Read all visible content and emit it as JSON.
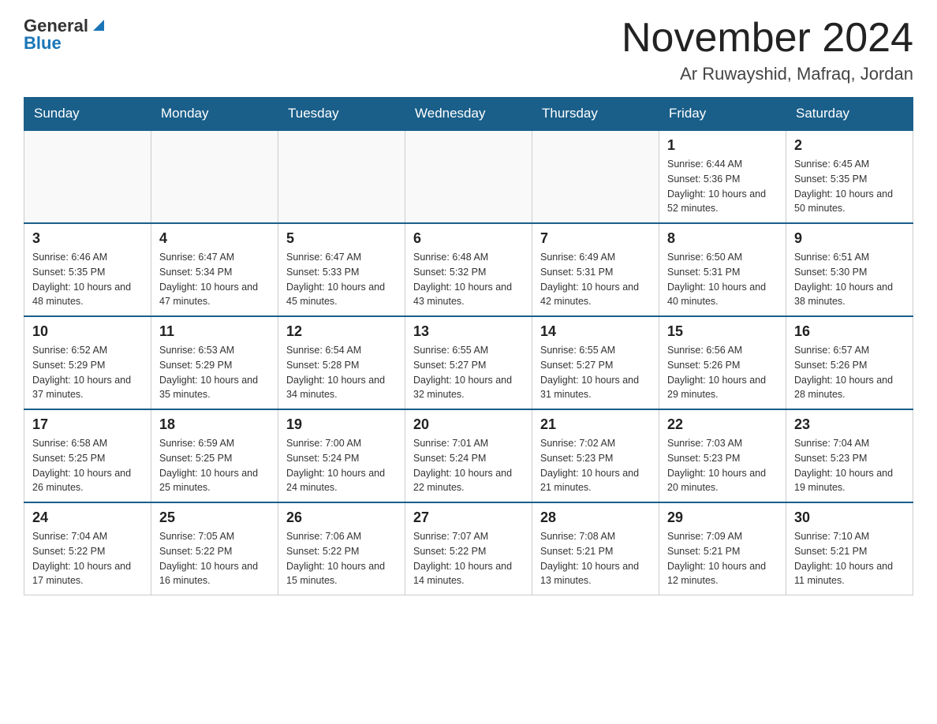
{
  "logo": {
    "general": "General",
    "blue": "Blue"
  },
  "title": {
    "month_year": "November 2024",
    "location": "Ar Ruwayshid, Mafraq, Jordan"
  },
  "weekdays": [
    "Sunday",
    "Monday",
    "Tuesday",
    "Wednesday",
    "Thursday",
    "Friday",
    "Saturday"
  ],
  "weeks": [
    [
      {
        "day": "",
        "info": ""
      },
      {
        "day": "",
        "info": ""
      },
      {
        "day": "",
        "info": ""
      },
      {
        "day": "",
        "info": ""
      },
      {
        "day": "",
        "info": ""
      },
      {
        "day": "1",
        "info": "Sunrise: 6:44 AM\nSunset: 5:36 PM\nDaylight: 10 hours and 52 minutes."
      },
      {
        "day": "2",
        "info": "Sunrise: 6:45 AM\nSunset: 5:35 PM\nDaylight: 10 hours and 50 minutes."
      }
    ],
    [
      {
        "day": "3",
        "info": "Sunrise: 6:46 AM\nSunset: 5:35 PM\nDaylight: 10 hours and 48 minutes."
      },
      {
        "day": "4",
        "info": "Sunrise: 6:47 AM\nSunset: 5:34 PM\nDaylight: 10 hours and 47 minutes."
      },
      {
        "day": "5",
        "info": "Sunrise: 6:47 AM\nSunset: 5:33 PM\nDaylight: 10 hours and 45 minutes."
      },
      {
        "day": "6",
        "info": "Sunrise: 6:48 AM\nSunset: 5:32 PM\nDaylight: 10 hours and 43 minutes."
      },
      {
        "day": "7",
        "info": "Sunrise: 6:49 AM\nSunset: 5:31 PM\nDaylight: 10 hours and 42 minutes."
      },
      {
        "day": "8",
        "info": "Sunrise: 6:50 AM\nSunset: 5:31 PM\nDaylight: 10 hours and 40 minutes."
      },
      {
        "day": "9",
        "info": "Sunrise: 6:51 AM\nSunset: 5:30 PM\nDaylight: 10 hours and 38 minutes."
      }
    ],
    [
      {
        "day": "10",
        "info": "Sunrise: 6:52 AM\nSunset: 5:29 PM\nDaylight: 10 hours and 37 minutes."
      },
      {
        "day": "11",
        "info": "Sunrise: 6:53 AM\nSunset: 5:29 PM\nDaylight: 10 hours and 35 minutes."
      },
      {
        "day": "12",
        "info": "Sunrise: 6:54 AM\nSunset: 5:28 PM\nDaylight: 10 hours and 34 minutes."
      },
      {
        "day": "13",
        "info": "Sunrise: 6:55 AM\nSunset: 5:27 PM\nDaylight: 10 hours and 32 minutes."
      },
      {
        "day": "14",
        "info": "Sunrise: 6:55 AM\nSunset: 5:27 PM\nDaylight: 10 hours and 31 minutes."
      },
      {
        "day": "15",
        "info": "Sunrise: 6:56 AM\nSunset: 5:26 PM\nDaylight: 10 hours and 29 minutes."
      },
      {
        "day": "16",
        "info": "Sunrise: 6:57 AM\nSunset: 5:26 PM\nDaylight: 10 hours and 28 minutes."
      }
    ],
    [
      {
        "day": "17",
        "info": "Sunrise: 6:58 AM\nSunset: 5:25 PM\nDaylight: 10 hours and 26 minutes."
      },
      {
        "day": "18",
        "info": "Sunrise: 6:59 AM\nSunset: 5:25 PM\nDaylight: 10 hours and 25 minutes."
      },
      {
        "day": "19",
        "info": "Sunrise: 7:00 AM\nSunset: 5:24 PM\nDaylight: 10 hours and 24 minutes."
      },
      {
        "day": "20",
        "info": "Sunrise: 7:01 AM\nSunset: 5:24 PM\nDaylight: 10 hours and 22 minutes."
      },
      {
        "day": "21",
        "info": "Sunrise: 7:02 AM\nSunset: 5:23 PM\nDaylight: 10 hours and 21 minutes."
      },
      {
        "day": "22",
        "info": "Sunrise: 7:03 AM\nSunset: 5:23 PM\nDaylight: 10 hours and 20 minutes."
      },
      {
        "day": "23",
        "info": "Sunrise: 7:04 AM\nSunset: 5:23 PM\nDaylight: 10 hours and 19 minutes."
      }
    ],
    [
      {
        "day": "24",
        "info": "Sunrise: 7:04 AM\nSunset: 5:22 PM\nDaylight: 10 hours and 17 minutes."
      },
      {
        "day": "25",
        "info": "Sunrise: 7:05 AM\nSunset: 5:22 PM\nDaylight: 10 hours and 16 minutes."
      },
      {
        "day": "26",
        "info": "Sunrise: 7:06 AM\nSunset: 5:22 PM\nDaylight: 10 hours and 15 minutes."
      },
      {
        "day": "27",
        "info": "Sunrise: 7:07 AM\nSunset: 5:22 PM\nDaylight: 10 hours and 14 minutes."
      },
      {
        "day": "28",
        "info": "Sunrise: 7:08 AM\nSunset: 5:21 PM\nDaylight: 10 hours and 13 minutes."
      },
      {
        "day": "29",
        "info": "Sunrise: 7:09 AM\nSunset: 5:21 PM\nDaylight: 10 hours and 12 minutes."
      },
      {
        "day": "30",
        "info": "Sunrise: 7:10 AM\nSunset: 5:21 PM\nDaylight: 10 hours and 11 minutes."
      }
    ]
  ]
}
